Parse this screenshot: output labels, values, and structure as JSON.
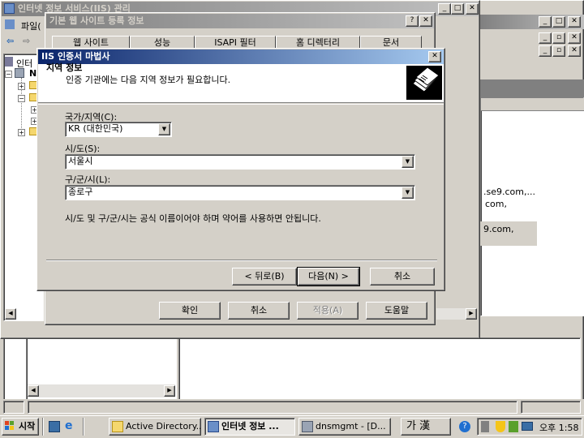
{
  "iis_window": {
    "title": "인터넷 정보 서비스(IIS) 관리",
    "menu_file": "파일("
  },
  "props_dialog": {
    "title": "기본 웹 사이트 등록 정보",
    "tabs": [
      "웹 사이트",
      "성능",
      "ISAPI 필터",
      "홈 디렉터리",
      "문서"
    ],
    "ok": "확인",
    "cancel": "취소",
    "apply": "적용(A)",
    "help": "도움말"
  },
  "tree": {
    "root_label": "인터"
  },
  "wizard": {
    "title": "IIS 인증서 마법사",
    "header_title": "지역 정보",
    "header_subtitle": "인증 기관에는 다음 지역 정보가 필요합니다.",
    "country_label": "국가/지역(C):",
    "country_value": "KR (대한민국)",
    "state_label": "시/도(S):",
    "state_value": "서울시",
    "city_label": "구/군/시(L):",
    "city_value": "종로구",
    "note": "시/도 및 구/군/시는 공식 이름이어야 하며 약어를 사용하면 안됩니다.",
    "back": "< 뒤로(B)",
    "next": "다음(N) >",
    "cancel": "취소"
  },
  "right_pane": {
    "line1": ".se9.com,...",
    "line2": "com,",
    "line3": "9.com,"
  },
  "taskbar": {
    "start": "시작",
    "tasks": [
      "Active Directory...",
      "인터넷 정보 ...",
      "dnsmgmt - [D..."
    ],
    "ime": "가 漢",
    "clock": "오후 1:58"
  },
  "colors": {
    "titlebar_active": "#0a246a",
    "titlebar_inactive": "#808080",
    "face": "#d4d0c8"
  }
}
